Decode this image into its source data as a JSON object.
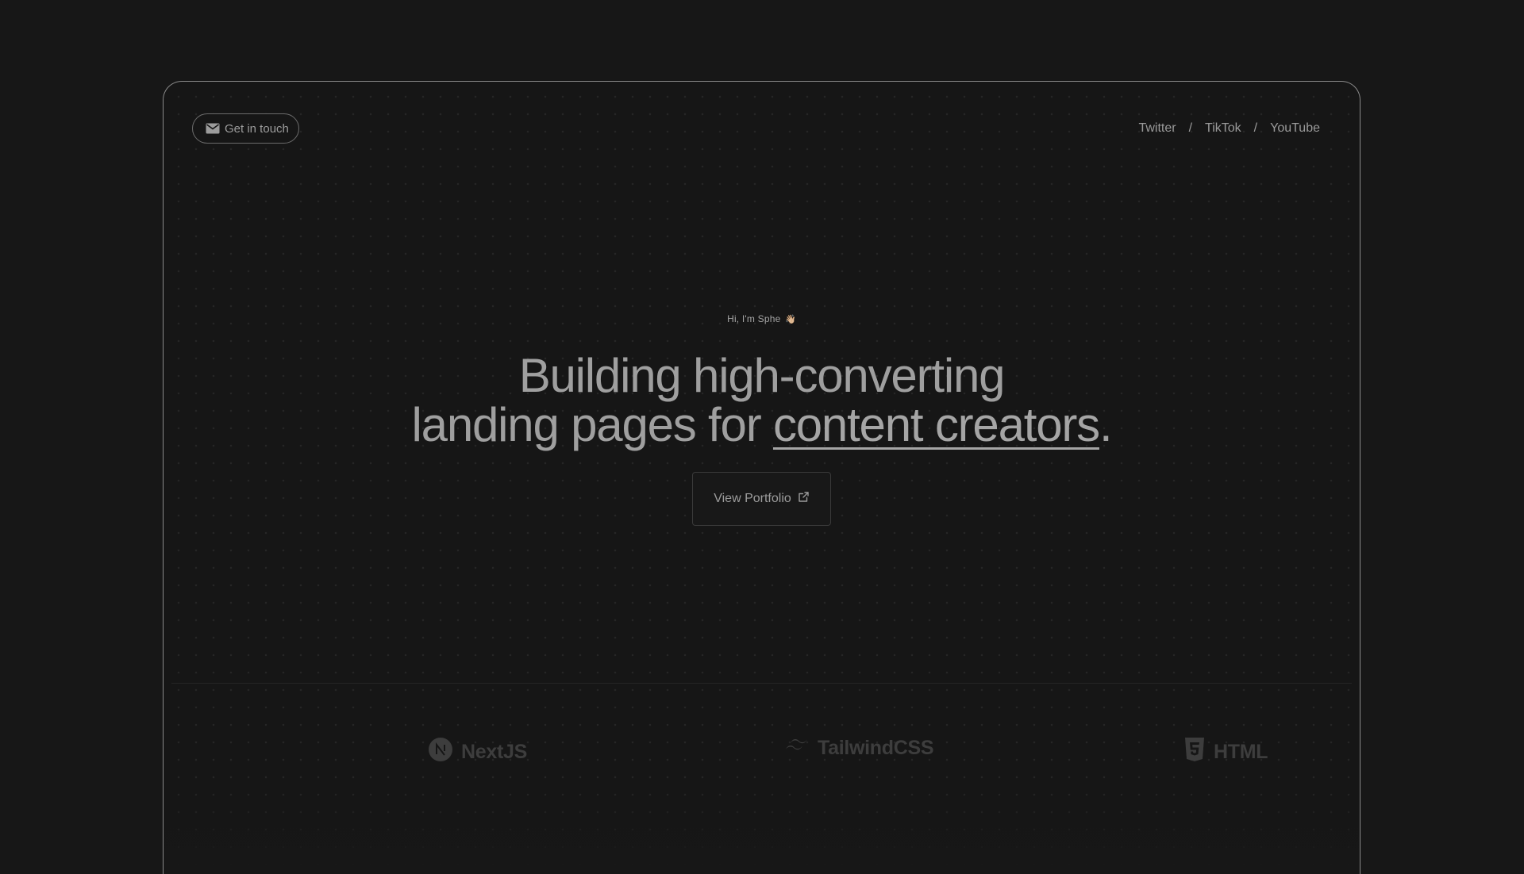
{
  "header": {
    "contact_label": "Get in touch",
    "contact_icon": "mail-icon",
    "social_links": [
      {
        "label": "Twitter"
      },
      {
        "label": "TikTok"
      },
      {
        "label": "YouTube"
      }
    ],
    "separator": "/"
  },
  "hero": {
    "greeting": "Hi, I'm Sphe",
    "greeting_emoji": "👋🏼",
    "headline_line1": "Building high-converting",
    "headline_line2_prefix": "landing pages for ",
    "headline_highlight": "content creators",
    "headline_suffix": ".",
    "cta_label": "View Portfolio",
    "cta_icon": "external-link-icon"
  },
  "tech_stack": [
    {
      "label": "NextJS",
      "icon": "nextjs-icon"
    },
    {
      "label": "TailwindCSS",
      "icon": "tailwind-icon"
    },
    {
      "label": "HTML",
      "icon": "html5-icon"
    }
  ],
  "colors": {
    "background": "#171717",
    "text": "#9f9f9f",
    "muted_logo": "#3d3d3d"
  }
}
